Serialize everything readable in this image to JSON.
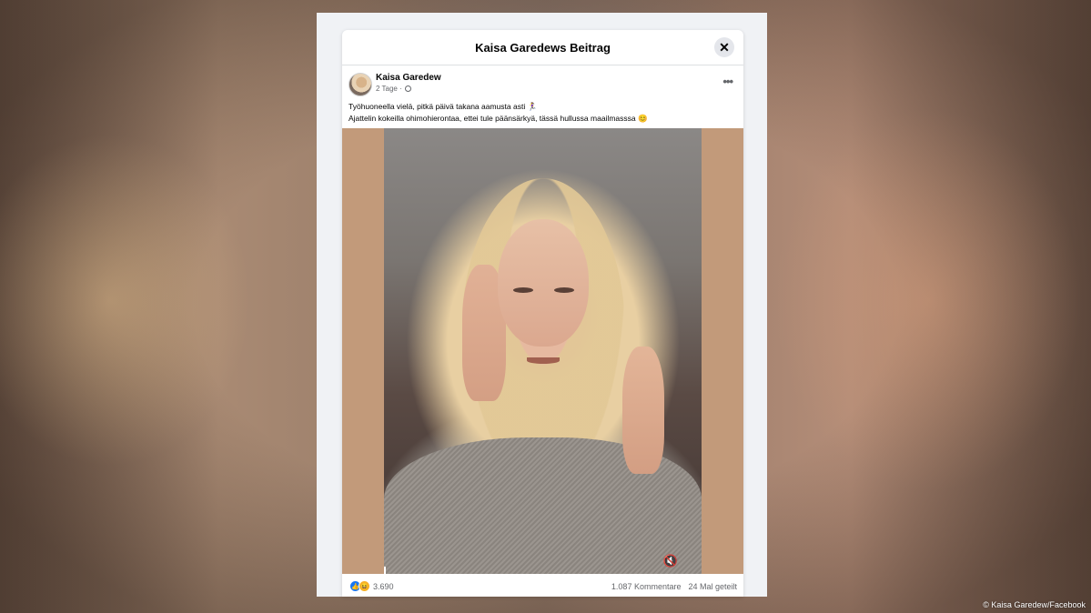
{
  "dialog": {
    "title": "Kaisa Garedews Beitrag",
    "close_glyph": "✕"
  },
  "post": {
    "author": "Kaisa Garedew",
    "time": "2 Tage ·",
    "more_glyph": "•••",
    "text_line1": "Työhuoneella vielä, pitkä päivä takana aamusta asti",
    "text_line1_emoji": "🏃‍♀️",
    "text_line2": "Ajattelin kokeilla ohimohierontaa, ettei tule päänsärkyä, tässä hullussa maailmasssa",
    "text_line2_emoji": "😊"
  },
  "stats": {
    "reaction_count": "3.690",
    "comments": "1.087 Kommentare",
    "shares": "24 Mal geteilt"
  },
  "icons": {
    "like": "👍",
    "haha": "😆",
    "mute": "🔇"
  },
  "credit": "© Kaisa Garedew/Facebook",
  "colors": {
    "accent": "#1877f2",
    "video_side": "#c29a7a"
  }
}
